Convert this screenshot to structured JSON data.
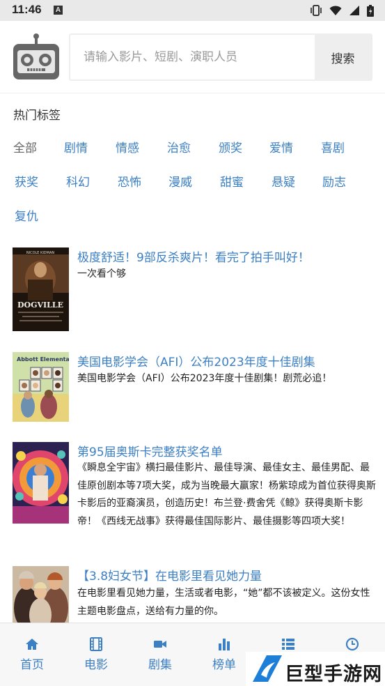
{
  "status_bar": {
    "time": "11:46",
    "notification_badge": "A"
  },
  "search": {
    "placeholder": "请输入影片、短剧、演职人员",
    "button_label": "搜索"
  },
  "tags": {
    "title": "热门标签",
    "items": [
      {
        "label": "全部",
        "active": true
      },
      {
        "label": "剧情",
        "active": false
      },
      {
        "label": "情感",
        "active": false
      },
      {
        "label": "治愈",
        "active": false
      },
      {
        "label": "颁奖",
        "active": false
      },
      {
        "label": "爱情",
        "active": false
      },
      {
        "label": "喜剧",
        "active": false
      },
      {
        "label": "获奖",
        "active": false
      },
      {
        "label": "科幻",
        "active": false
      },
      {
        "label": "恐怖",
        "active": false
      },
      {
        "label": "漫威",
        "active": false
      },
      {
        "label": "甜蜜",
        "active": false
      },
      {
        "label": "悬疑",
        "active": false
      },
      {
        "label": "励志",
        "active": false
      },
      {
        "label": "复仇",
        "active": false
      }
    ]
  },
  "articles": [
    {
      "title": "极度舒适！9部反杀爽片！看完了拍手叫好！",
      "desc": "一次看个够",
      "poster_text": "DOGVILLE",
      "poster_top": "NICOLE KIDMAN"
    },
    {
      "title": "美国电影学会（AFI）公布2023年度十佳剧集",
      "desc": "美国电影学会（AFI）公布2023年度十佳剧集！剧荒必追！",
      "poster_text": "Abbott Elementary"
    },
    {
      "title": "第95届奥斯卡完整获奖名单",
      "desc": "《瞬息全宇宙》横扫最佳影片、最佳导演、最佳女主、最佳男配、最佳原创剧本等7项大奖，成为当晚最大赢家！杨紫琼成为首位获得奥斯卡影后的亚裔演员，创造历史！布兰登·费舍凭《鲸》获得奥斯卡影帝！《西线无战事》获得最佳国际影片、最佳摄影等四项大奖！"
    },
    {
      "title": "【3.8妇女节】在电影里看见她力量",
      "desc": "在电影里看见她力量，生活或者电影，“她”都不该被定义。这份女性主题电影盘点，送给有力量的你。"
    }
  ],
  "bottom_nav": [
    {
      "label": "首页",
      "icon": "home-icon"
    },
    {
      "label": "电影",
      "icon": "film-icon"
    },
    {
      "label": "剧集",
      "icon": "video-camera-icon"
    },
    {
      "label": "榜单",
      "icon": "bar-chart-icon"
    },
    {
      "label": "",
      "icon": "list-icon"
    },
    {
      "label": "",
      "icon": "clock-icon"
    }
  ],
  "watermark": {
    "text": "巨型手游网"
  },
  "colors": {
    "accent": "#3b7fc4",
    "nav_bg": "#f7f7f7",
    "search_btn_bg": "#eeeeee"
  }
}
